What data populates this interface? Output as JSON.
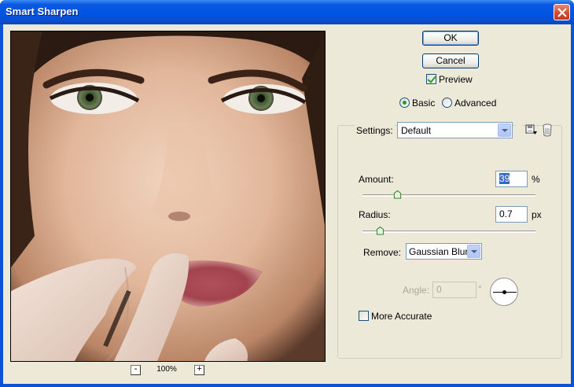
{
  "window": {
    "title": "Smart Sharpen"
  },
  "preview": {
    "zoom_level": "100%",
    "zoom_out_label": "-",
    "zoom_in_label": "+"
  },
  "buttons": {
    "ok": "OK",
    "cancel": "Cancel"
  },
  "preview_checkbox": {
    "label": "Preview",
    "checked": true
  },
  "mode": {
    "basic_label": "Basic",
    "advanced_label": "Advanced",
    "selected": "Basic"
  },
  "settings": {
    "label": "Settings:",
    "value": "Default"
  },
  "amount": {
    "label": "Amount:",
    "value": "39",
    "unit": "%",
    "slider_fraction": 0.2
  },
  "radius": {
    "label": "Radius:",
    "value": "0.7",
    "unit": "px",
    "slider_fraction": 0.1
  },
  "remove": {
    "label": "Remove:",
    "value": "Gaussian Blur"
  },
  "angle": {
    "label": "Angle:",
    "value": "0",
    "unit": "°",
    "enabled": false
  },
  "more_accurate": {
    "label": "More Accurate",
    "checked": false
  },
  "colors": {
    "titlebar": "#0054e3",
    "client_bg": "#ece9d8",
    "selection": "#316ac5",
    "checkmark": "#21a121"
  }
}
